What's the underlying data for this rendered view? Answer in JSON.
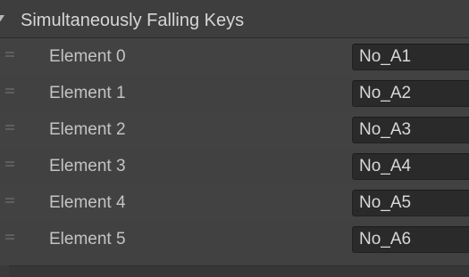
{
  "header": {
    "title": "Simultaneously Falling Keys",
    "icon": "foldout-arrow-icon"
  },
  "list": {
    "items": [
      {
        "label": "Element 0",
        "value": "No_A1"
      },
      {
        "label": "Element 1",
        "value": "No_A2"
      },
      {
        "label": "Element 2",
        "value": "No_A3"
      },
      {
        "label": "Element 3",
        "value": "No_A4"
      },
      {
        "label": "Element 4",
        "value": "No_A5"
      },
      {
        "label": "Element 5",
        "value": "No_A6"
      }
    ]
  },
  "colors": {
    "background": "#3a3a3a",
    "field_background": "#2a2a2a",
    "text": "#c4c4c4"
  }
}
